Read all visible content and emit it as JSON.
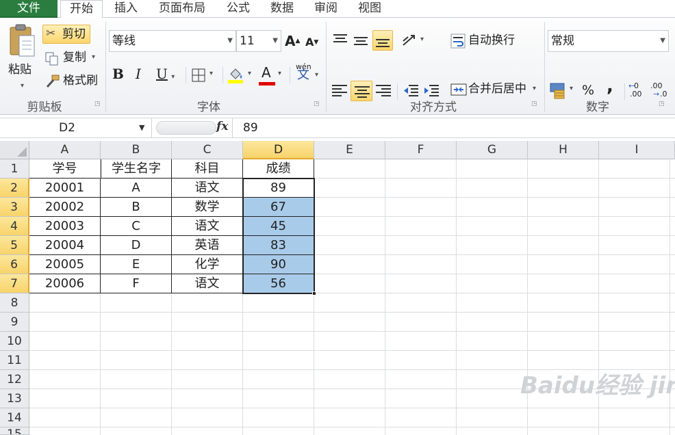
{
  "tabs": [
    {
      "label": "文件"
    },
    {
      "label": "开始"
    },
    {
      "label": "插入"
    },
    {
      "label": "页面布局"
    },
    {
      "label": "公式"
    },
    {
      "label": "数据"
    },
    {
      "label": "审阅"
    },
    {
      "label": "视图"
    }
  ],
  "ribbon": {
    "clipboard": {
      "paste": "粘贴",
      "cut": "剪切",
      "copy": "复制",
      "format_painter": "格式刷",
      "label": "剪贴板"
    },
    "font": {
      "name": "等线",
      "size": "11",
      "bold": "B",
      "italic": "I",
      "underline": "U",
      "grow": "A",
      "shrink": "A",
      "font_color": "A",
      "phonetic": "wén",
      "phonetic_char": "文",
      "label": "字体"
    },
    "alignment": {
      "wrap": "自动换行",
      "merge": "合并后居中",
      "label": "对齐方式"
    },
    "number": {
      "format": "常规",
      "percent": "%",
      "comma": ",",
      "inc_decimal": ".00",
      "dec_decimal": ".0",
      "label": "数字"
    }
  },
  "formula_bar": {
    "name_box": "D2",
    "fx": "fx",
    "content": "89"
  },
  "columns": [
    "A",
    "B",
    "C",
    "D",
    "E",
    "F",
    "G",
    "H",
    "I"
  ],
  "rows": [
    "1",
    "2",
    "3",
    "4",
    "5",
    "6",
    "7",
    "8",
    "9",
    "10",
    "11",
    "12",
    "13",
    "14",
    "15"
  ],
  "table": {
    "headers": [
      "学号",
      "学生名字",
      "科目",
      "成绩"
    ],
    "rows": [
      [
        "20001",
        "A",
        "语文",
        "89"
      ],
      [
        "20002",
        "B",
        "数学",
        "67"
      ],
      [
        "20003",
        "C",
        "语文",
        "45"
      ],
      [
        "20004",
        "D",
        "英语",
        "83"
      ],
      [
        "20005",
        "E",
        "化学",
        "90"
      ],
      [
        "20006",
        "F",
        "语文",
        "56"
      ]
    ]
  },
  "colors": {
    "file_tab": "#2a7d3f",
    "selection_fill": "#a9cbea",
    "header_highlight": "#f8d36a"
  },
  "watermark": "Baidu经验 jingyan.baidu.com"
}
